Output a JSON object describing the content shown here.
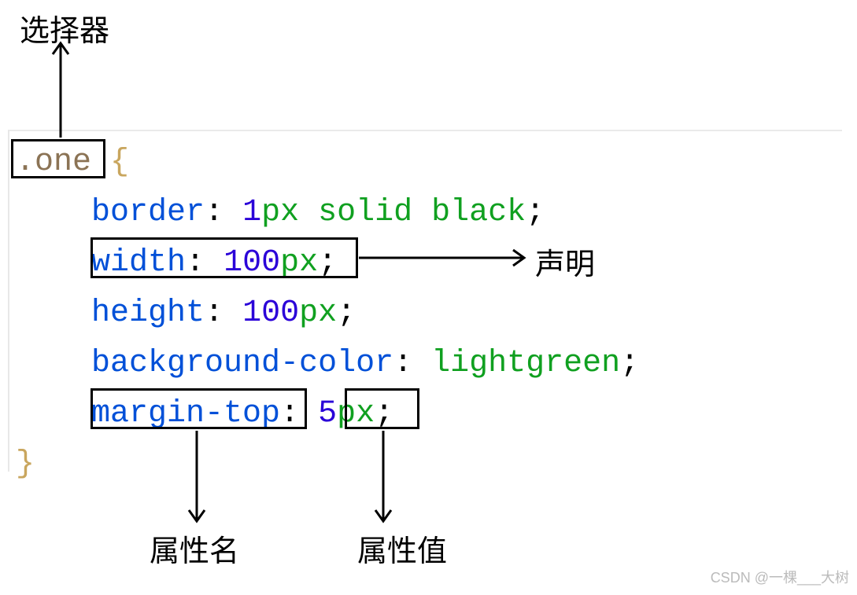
{
  "labels": {
    "selector": "选择器",
    "declaration": "声明",
    "propertyName": "属性名",
    "propertyValue": "属性值"
  },
  "code": {
    "selector": ".one",
    "openBrace": "{",
    "closeBrace": "}",
    "declarations": [
      {
        "prop": "border",
        "value_num": "1",
        "value_unit": "px",
        "value_rest": " solid black"
      },
      {
        "prop": "width",
        "value_num": "100",
        "value_unit": "px",
        "value_rest": ""
      },
      {
        "prop": "height",
        "value_num": "100",
        "value_unit": "px",
        "value_rest": ""
      },
      {
        "prop": "background-color",
        "value_num": "",
        "value_unit": "",
        "value_rest": " lightgreen"
      },
      {
        "prop": "margin-top",
        "value_num": "5",
        "value_unit": "px",
        "value_rest": ""
      }
    ]
  },
  "watermark": "CSDN @一棵___大树"
}
